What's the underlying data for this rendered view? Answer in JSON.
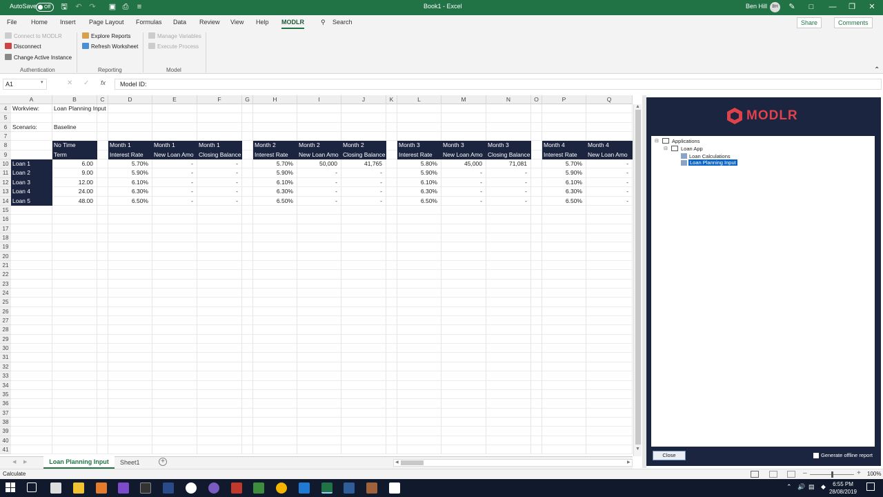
{
  "titlebar": {
    "autosave": "AutoSave",
    "toggle": "Off",
    "title": "Book1  -  Excel",
    "user": "Ben Hill",
    "initials": "BH"
  },
  "menu": {
    "items": [
      "File",
      "Home",
      "Insert",
      "Page Layout",
      "Formulas",
      "Data",
      "Review",
      "View",
      "Help",
      "MODLR"
    ],
    "search": "Search",
    "share": "Share",
    "comments": "Comments"
  },
  "ribbon": {
    "auth": {
      "connect": "Connect to MODLR",
      "disconnect": "Disconnect",
      "change": "Change Active Instance",
      "group": "Authentication"
    },
    "reporting": {
      "explore": "Explore Reports",
      "refresh": "Refresh Worksheet",
      "group": "Reporting"
    },
    "model": {
      "manage": "Manage Variables",
      "execute": "Execute Process",
      "group": "Model"
    }
  },
  "formula": {
    "namebox": "A1",
    "value": "Model ID:",
    "fx": "fx"
  },
  "columns": [
    "A",
    "B",
    "C",
    "D",
    "E",
    "F",
    "G",
    "H",
    "I",
    "J",
    "K",
    "L",
    "M",
    "N",
    "O",
    "P",
    "Q"
  ],
  "rows": [
    "4",
    "5",
    "6",
    "7",
    "8",
    "9",
    "10",
    "11",
    "12",
    "13",
    "14",
    "15",
    "16",
    "17",
    "18",
    "19",
    "20",
    "21",
    "22",
    "23",
    "24",
    "25",
    "26",
    "27",
    "28",
    "29",
    "30",
    "31",
    "32",
    "33",
    "34",
    "35",
    "36",
    "37",
    "38",
    "39",
    "40",
    "41"
  ],
  "sheet": {
    "workview_label": "Workview:",
    "workview_value": "Loan Planning Input",
    "scenario_label": "Scenario:",
    "scenario_value": "Baseline",
    "b_head": [
      "No Time",
      "Term"
    ],
    "month_heads": [
      [
        "Month 1",
        "Month 1",
        "Month 1"
      ],
      [
        "Month 2",
        "Month 2",
        "Month 2"
      ],
      [
        "Month 3",
        "Month 3",
        "Month 3"
      ],
      [
        "Month 4",
        "Month 4"
      ]
    ],
    "sub_heads": [
      "Interest Rate",
      "New Loan Amo",
      "Closing Balance"
    ],
    "loans": [
      {
        "name": "Loan 1",
        "term": "6.00",
        "m1": [
          "5.70%",
          "-",
          "-"
        ],
        "m2": [
          "5.70%",
          "50,000",
          "41,765"
        ],
        "m3": [
          "5.80%",
          "45,000",
          "71,081"
        ],
        "m4": [
          "5.70%",
          "-"
        ]
      },
      {
        "name": "Loan 2",
        "term": "9.00",
        "m1": [
          "5.90%",
          "-",
          "-"
        ],
        "m2": [
          "5.90%",
          "-",
          "-"
        ],
        "m3": [
          "5.90%",
          "-",
          "-"
        ],
        "m4": [
          "5.90%",
          "-"
        ]
      },
      {
        "name": "Loan 3",
        "term": "12.00",
        "m1": [
          "6.10%",
          "-",
          "-"
        ],
        "m2": [
          "6.10%",
          "-",
          "-"
        ],
        "m3": [
          "6.10%",
          "-",
          "-"
        ],
        "m4": [
          "6.10%",
          "-"
        ]
      },
      {
        "name": "Loan 4",
        "term": "24.00",
        "m1": [
          "6.30%",
          "-",
          "-"
        ],
        "m2": [
          "6.30%",
          "-",
          "-"
        ],
        "m3": [
          "6.30%",
          "-",
          "-"
        ],
        "m4": [
          "6.30%",
          "-"
        ]
      },
      {
        "name": "Loan 5",
        "term": "48.00",
        "m1": [
          "6.50%",
          "-",
          "-"
        ],
        "m2": [
          "6.50%",
          "-",
          "-"
        ],
        "m3": [
          "6.50%",
          "-",
          "-"
        ],
        "m4": [
          "6.50%",
          "-"
        ]
      }
    ]
  },
  "panel": {
    "logo": "MODLR",
    "tree": {
      "root": "Applications",
      "app": "Loan App",
      "child1": "Loan Calculations",
      "child2": "Loan Planning Input"
    },
    "close": "Close",
    "offline": "Generate offline report"
  },
  "tabs": {
    "active": "Loan Planning Input",
    "other": "Sheet1",
    "add": "+"
  },
  "status": {
    "text": "Calculate",
    "zoom": "100%"
  },
  "taskbar": {
    "time": "6:55 PM",
    "date": "28/08/2019"
  },
  "colors": {
    "excel_green": "#217346",
    "dark_navy": "#1c2540",
    "modlr_red": "#e0424b"
  }
}
